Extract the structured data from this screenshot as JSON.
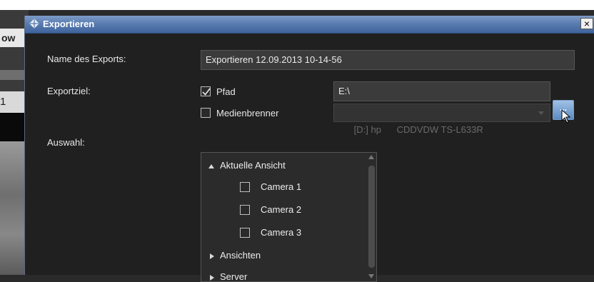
{
  "background": {
    "tab_text": "ow",
    "tab2_text": "1"
  },
  "dialog": {
    "title": "Exportieren",
    "close_label": "×"
  },
  "form": {
    "name_label": "Name des Exports:",
    "name_value": "Exportieren 12.09.2013 10-14-56",
    "target_label": "Exportziel:",
    "path_option": {
      "label": "Pfad",
      "checked": true
    },
    "path_value": "E:\\",
    "browse_label": "...",
    "burner_option": {
      "label": "Medienbrenner",
      "checked": false
    },
    "burner_value": "[D:] hp      CDDVDW TS-L633R",
    "selection_label": "Auswahl:"
  },
  "tree": {
    "items": [
      {
        "label": "Aktuelle Ansicht",
        "expanded": true
      },
      {
        "label": "Camera 1",
        "checked": false
      },
      {
        "label": "Camera 2",
        "checked": false
      },
      {
        "label": "Camera 3",
        "checked": false
      },
      {
        "label": "Ansichten",
        "expanded": false
      },
      {
        "label": "Server",
        "expanded": false
      }
    ]
  },
  "colors": {
    "titlebar": "#5a7db1",
    "dialog_bg": "#202020",
    "field_bg": "#3b3b3b",
    "browse_button": "#6f9bd0"
  }
}
